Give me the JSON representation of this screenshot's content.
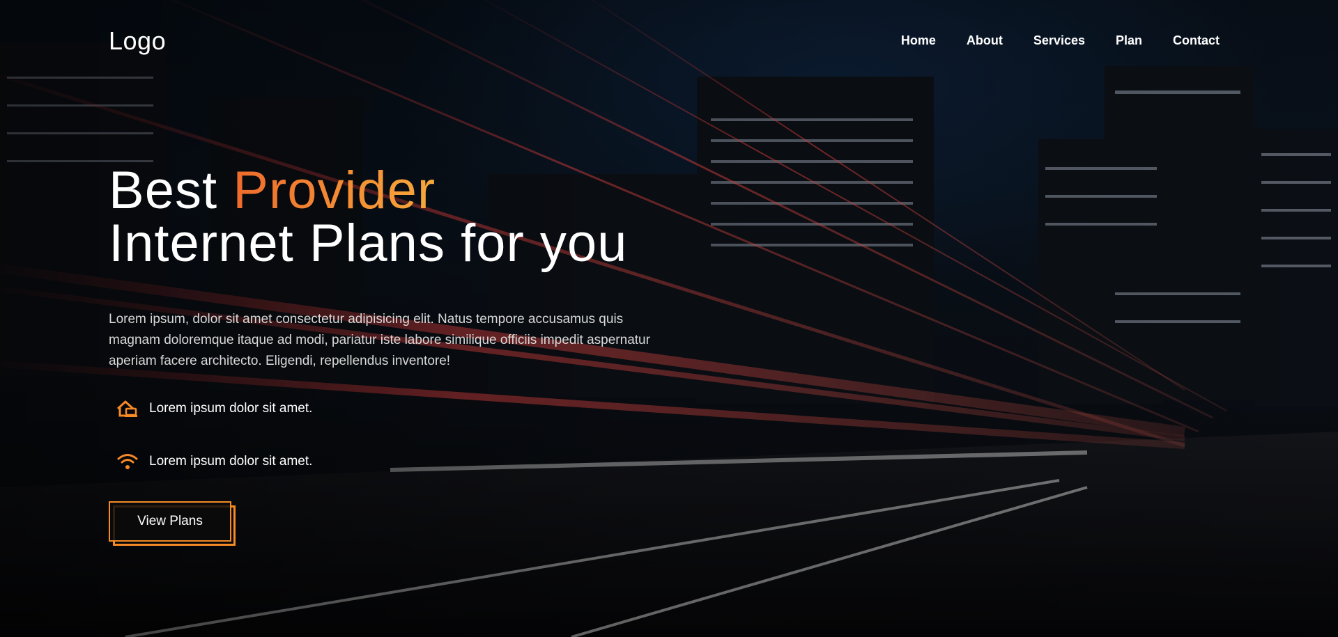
{
  "nav": {
    "logo": "Logo",
    "items": [
      {
        "label": "Home"
      },
      {
        "label": "About"
      },
      {
        "label": "Services"
      },
      {
        "label": "Plan"
      },
      {
        "label": "Contact"
      }
    ]
  },
  "hero": {
    "title_line1_prefix": "Best ",
    "title_line1_accent": "Provider",
    "title_line2": "Internet Plans for you",
    "description": "Lorem ipsum, dolor sit amet consectetur adipisicing elit. Natus tempore accusamus quis magnam doloremque itaque ad modi, pariatur iste labore similique officiis impedit aspernatur aperiam facere architecto. Eligendi, repellendus inventore!",
    "features": [
      {
        "icon": "house-laptop-icon",
        "text": "Lorem ipsum dolor sit amet."
      },
      {
        "icon": "wifi-icon",
        "text": "Lorem ipsum dolor sit amet."
      }
    ],
    "cta_label": "View Plans"
  },
  "colors": {
    "accent": "#f58a27",
    "accent_gradient_start": "#ef6b2c",
    "accent_gradient_end": "#f7a93b",
    "text": "#ffffff",
    "muted_text": "#d9d9d9"
  }
}
